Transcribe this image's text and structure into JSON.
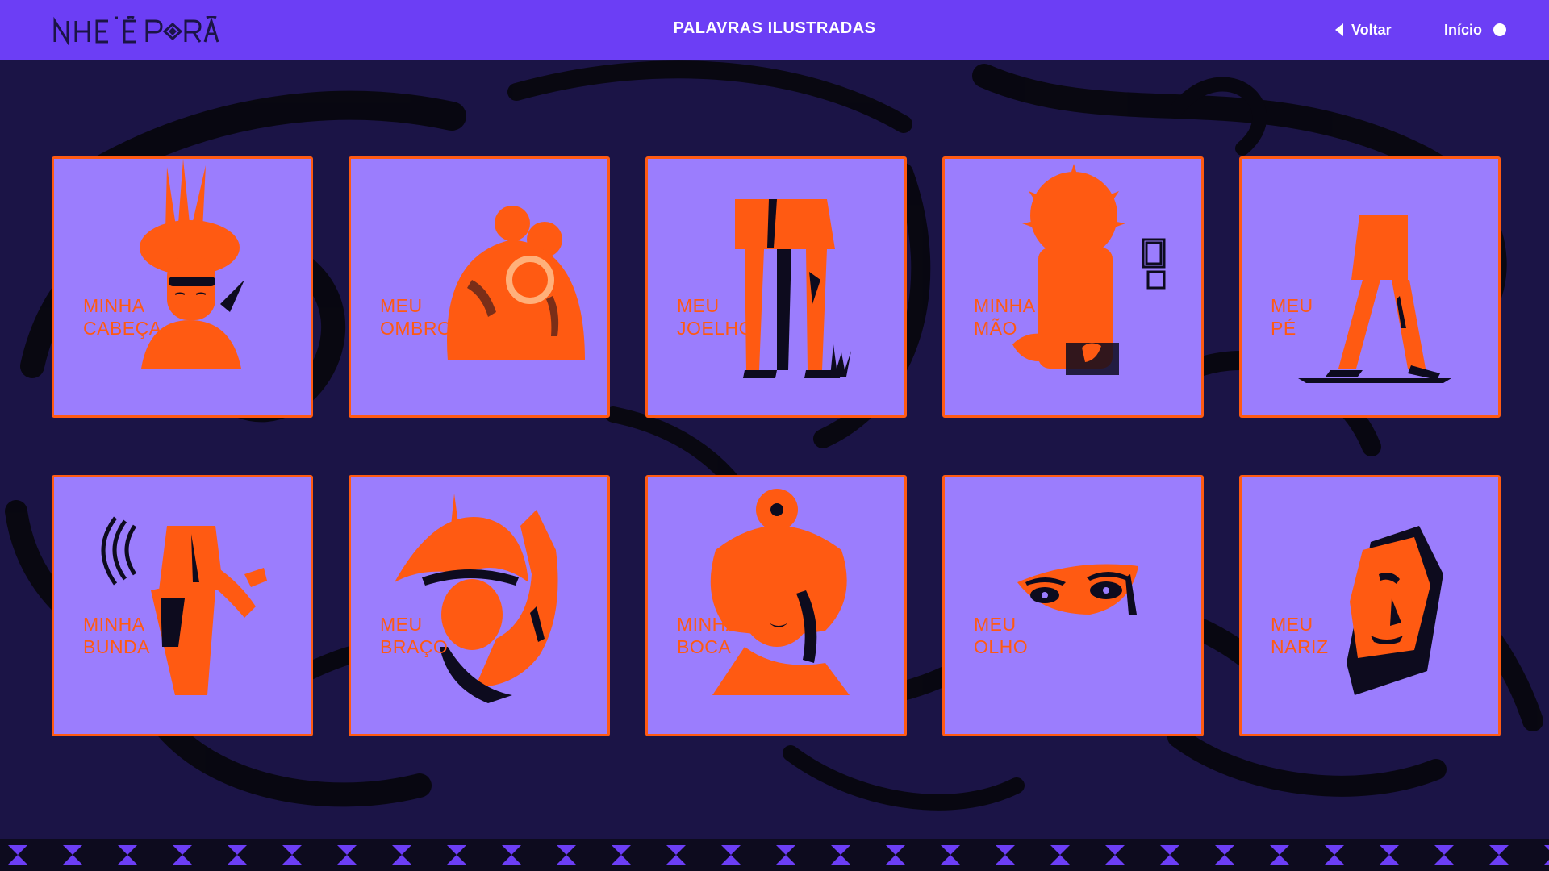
{
  "app": {
    "logo_text": "NHE'Ẽ PORÃ",
    "title": "PALAVRAS ILUSTRADAS"
  },
  "nav": {
    "back_label": "Voltar",
    "home_label": "Início"
  },
  "cards": [
    {
      "line1": "MINHA",
      "line2": "CABEÇA",
      "icon": "head-headdress-figure"
    },
    {
      "line1": "MEU",
      "line2": "OMBRO",
      "icon": "shoulders-embrace-figure"
    },
    {
      "line1": "MEU",
      "line2": "JOELHO",
      "icon": "legs-knee-figure"
    },
    {
      "line1": "MINHA",
      "line2": "MÃO",
      "icon": "hands-sun-figure"
    },
    {
      "line1": "MEU",
      "line2": "PÉ",
      "icon": "walking-feet-figure"
    },
    {
      "line1": "MINHA",
      "line2": "BUNDA",
      "icon": "dancing-hips-figure"
    },
    {
      "line1": "MEU",
      "line2": "BRAÇO",
      "icon": "raised-arm-figure"
    },
    {
      "line1": "MINHA",
      "line2": "BOCA",
      "icon": "face-mouth-figure"
    },
    {
      "line1": "MEU",
      "line2": "OLHO",
      "icon": "eyes-figure"
    },
    {
      "line1": "MEU",
      "line2": "NARIZ",
      "icon": "face-nose-figure"
    }
  ],
  "colors": {
    "header": "#6c3ef5",
    "background": "#1b1446",
    "card": "#9b7dfd",
    "accent": "#ff5a12",
    "shadow": "#0d0b1e"
  }
}
